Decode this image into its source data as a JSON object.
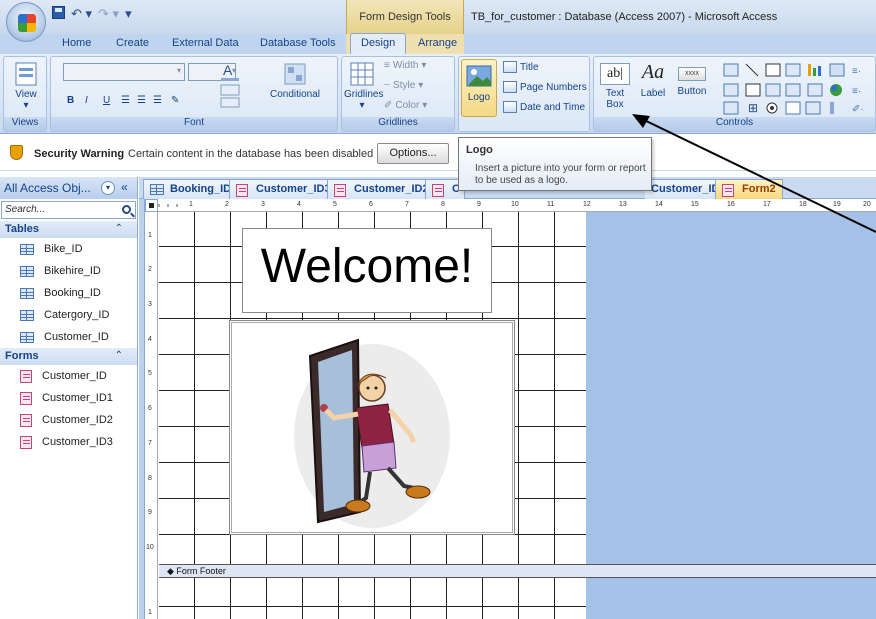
{
  "window": {
    "context_tab_title": "Form Design Tools",
    "title": "TB_for_customer : Database (Access 2007) - Microsoft Access"
  },
  "qat": {
    "undo": "↶ ▾",
    "redo": "↷ ▾",
    "customize": "▾"
  },
  "ribbon_tabs": [
    "Home",
    "Create",
    "External Data",
    "Database Tools",
    "Design",
    "Arrange"
  ],
  "active_tab": "Design",
  "ribbon": {
    "views": {
      "button": "View",
      "label": "Views"
    },
    "font": {
      "label": "Font",
      "conditional": "Conditional",
      "bold": "B",
      "italic": "I",
      "underline": "U"
    },
    "gridlines": {
      "button": "Gridlines",
      "width": "Width",
      "style": "Style",
      "color": "Color",
      "label": "Gridlines"
    },
    "header_footer": {
      "logo": "Logo",
      "title": "Title",
      "page_numbers": "Page Numbers",
      "date_time": "Date and Time"
    },
    "controls": {
      "text_box_line1": "Text",
      "text_box_line2": "Box",
      "label_btn": "Label",
      "button_btn": "Button",
      "label": "Controls",
      "textbox_glyph": "ab|",
      "label_glyph": "Aa",
      "button_glyph": "xxxx"
    }
  },
  "security": {
    "title": "Security Warning",
    "message": "Certain content in the database has been disabled",
    "options_button": "Options..."
  },
  "tooltip": {
    "title": "Logo",
    "body": "Insert a picture into your form or report to be used as a logo."
  },
  "nav": {
    "header": "All Access Obj...",
    "collapse": "«",
    "search_placeholder": "Search...",
    "tables_title": "Tables",
    "tables": [
      "Bike_ID",
      "Bikehire_ID",
      "Booking_ID",
      "Catergory_ID",
      "Customer_ID"
    ],
    "forms_title": "Forms",
    "forms": [
      "Customer_ID",
      "Customer_ID1",
      "Customer_ID2",
      "Customer_ID3"
    ]
  },
  "doc_tabs": [
    "Booking_ID",
    "Customer_ID3",
    "Customer_ID2",
    "C",
    "Customer_ID",
    "Form2"
  ],
  "active_doc_tab": "Form2",
  "form": {
    "welcome_text": "Welcome!",
    "footer_label": "Form Footer"
  },
  "ruler": {
    "h_numbers": [
      "1",
      "2",
      "3",
      "4",
      "5",
      "6",
      "7",
      "8",
      "9",
      "10",
      "11",
      "12",
      "13",
      "14",
      "15",
      "16",
      "17",
      "18",
      "19",
      "20"
    ],
    "v_numbers": [
      "1",
      "2",
      "3",
      "4",
      "5",
      "6",
      "7",
      "8",
      "9",
      "10",
      "1"
    ]
  },
  "colors": {
    "ribbon_blue": "#bfd4ee",
    "context_gold": "#e6d28c",
    "form2_tab": "#f8d77e",
    "canvas_blue": "#a4c1e8"
  }
}
